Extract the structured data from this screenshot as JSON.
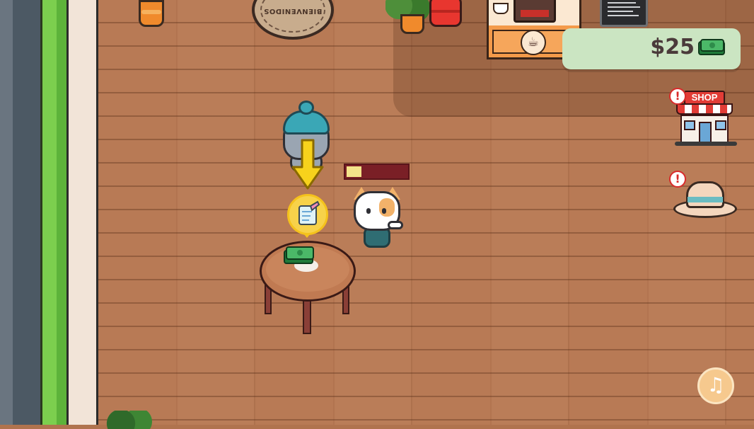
{
  "hud": {
    "money": "$25",
    "money_icon": "cash-icon",
    "accent_color": "#cbe5c2"
  },
  "side_buttons": {
    "shop_label": "SHOP",
    "shop_alert": "!",
    "hat_alert": "!",
    "music_icon": "music-note-icon"
  },
  "scene": {
    "welcome_mat_text": "BIENVENIDOS",
    "order_icon": "order-notepad-icon",
    "service_progress": 0.25,
    "table_item": "cash-stack-icon"
  }
}
